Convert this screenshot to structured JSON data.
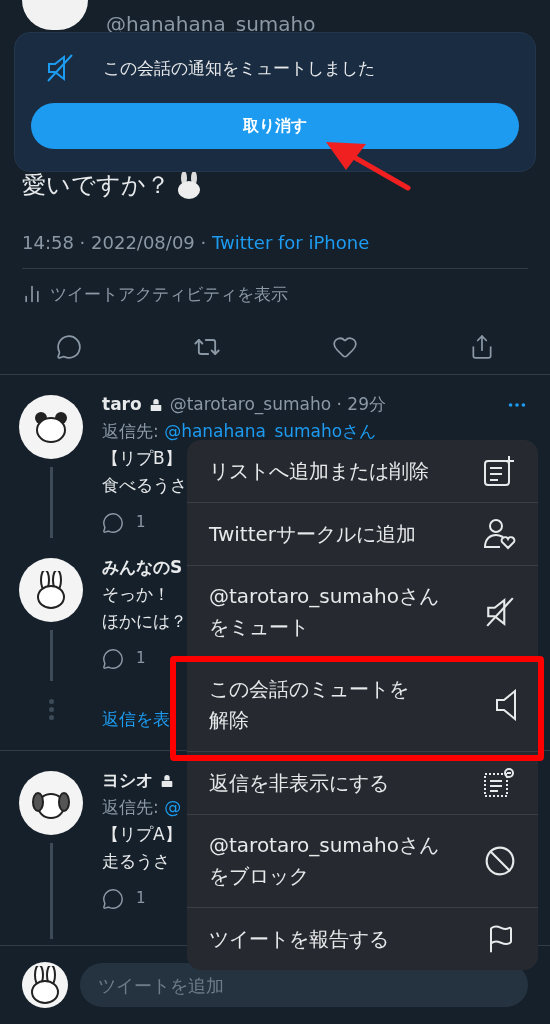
{
  "top_tweet": {
    "handle": "@hanahana_sumaho",
    "text": "愛いですか？",
    "time": "14:58 · 2022/08/09 · ",
    "source": "Twitter for iPhone",
    "activity": "ツイートアクティビティを表示"
  },
  "toast": {
    "message": "この会話の通知をミュートしました",
    "button": "取り消す"
  },
  "replies": [
    {
      "name": "taro",
      "locked": true,
      "handle": "@tarotaro_sumaho · 29分",
      "reply_to_label": "返信先: ",
      "reply_to": "@hanahana_sumahoさん",
      "lines": [
        "【リプB】",
        "食べるうさ"
      ],
      "reply_count": "1"
    },
    {
      "name": "みんなのS",
      "locked": false,
      "lines": [
        "そっか！",
        "ほかには？"
      ],
      "reply_count": "1",
      "show_replies": "返信を表"
    },
    {
      "name": "ヨシオ",
      "locked": true,
      "reply_to_label": "返信先: ",
      "reply_to": "@",
      "lines": [
        "【リプA】",
        "走るうさ"
      ],
      "reply_count": "1"
    }
  ],
  "menu": {
    "items": [
      {
        "lines": [
          "リストへ追加または削除"
        ],
        "highlighted": false
      },
      {
        "lines": [
          "Twitterサークルに追加"
        ],
        "highlighted": false
      },
      {
        "lines": [
          "@tarotaro_sumahoさん",
          "をミュート"
        ],
        "highlighted": false
      },
      {
        "lines": [
          "この会話のミュートを",
          "解除"
        ],
        "highlighted": true
      },
      {
        "lines": [
          "返信を非表示にする"
        ],
        "highlighted": false
      },
      {
        "lines": [
          "@tarotaro_sumahoさん",
          "をブロック"
        ],
        "highlighted": false
      },
      {
        "lines": [
          "ツイートを報告する"
        ],
        "highlighted": false
      }
    ]
  },
  "composer": {
    "placeholder": "ツイートを追加"
  }
}
